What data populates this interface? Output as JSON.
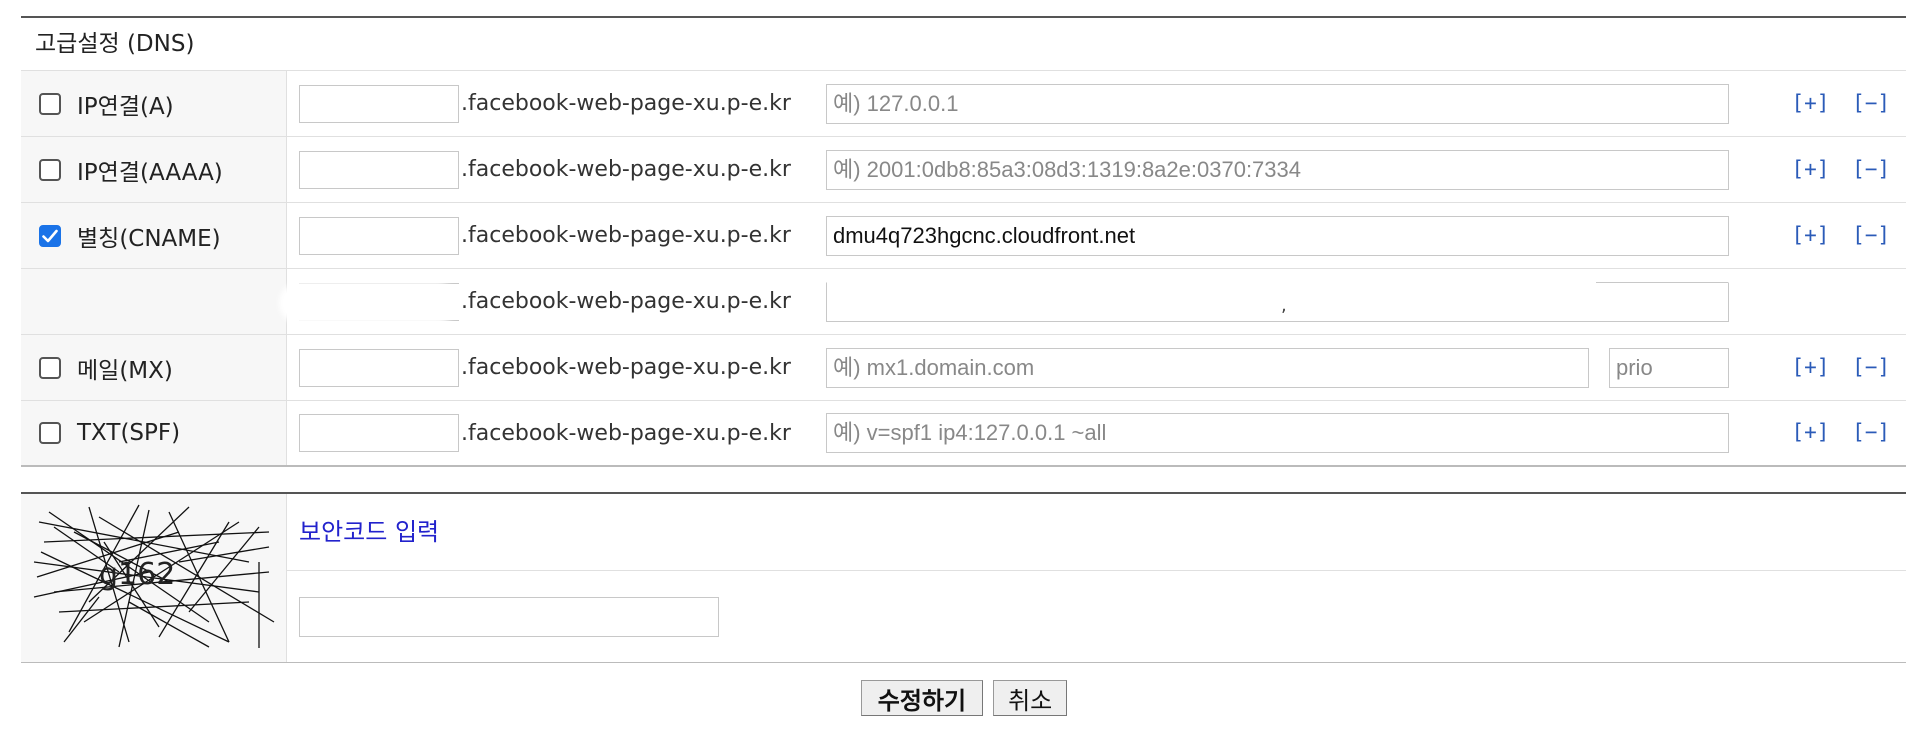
{
  "section_title": "고급설정 (DNS)",
  "domain_suffix": ".facebook-web-page-xu.p-e.kr",
  "actions": {
    "add": "[+]",
    "remove": "[−]"
  },
  "records": [
    {
      "label": "IP연결(A)",
      "checked": false,
      "subdomain": "",
      "placeholder": "예) 127.0.0.1",
      "value": ""
    },
    {
      "label": "IP연결(AAAA)",
      "checked": false,
      "subdomain": "",
      "placeholder": "예) 2001:0db8:85a3:08d3:1319:8a2e:0370:7334",
      "value": ""
    },
    {
      "label": "별칭(CNAME)",
      "checked": true,
      "subdomain": "",
      "placeholder": "",
      "value": "dmu4q723hgcnc.cloudfront.net"
    },
    {
      "label": "",
      "checked": false,
      "subdomain": "",
      "placeholder": "",
      "value": ""
    },
    {
      "label": "메일(MX)",
      "checked": false,
      "subdomain": "",
      "placeholder": "예) mx1.domain.com",
      "value": "",
      "prio_placeholder": "prio"
    },
    {
      "label": "TXT(SPF)",
      "checked": false,
      "subdomain": "",
      "placeholder": "예) v=spf1 ip4:127.0.0.1 ~all",
      "value": ""
    }
  ],
  "security": {
    "label": "보안코드 입력",
    "captcha_text": "g162",
    "input_value": ""
  },
  "buttons": {
    "submit": "수정하기",
    "cancel": "취소"
  },
  "colors": {
    "accent": "#1a73e8",
    "link": "#2b5bb8",
    "security_label": "#2222cc"
  }
}
